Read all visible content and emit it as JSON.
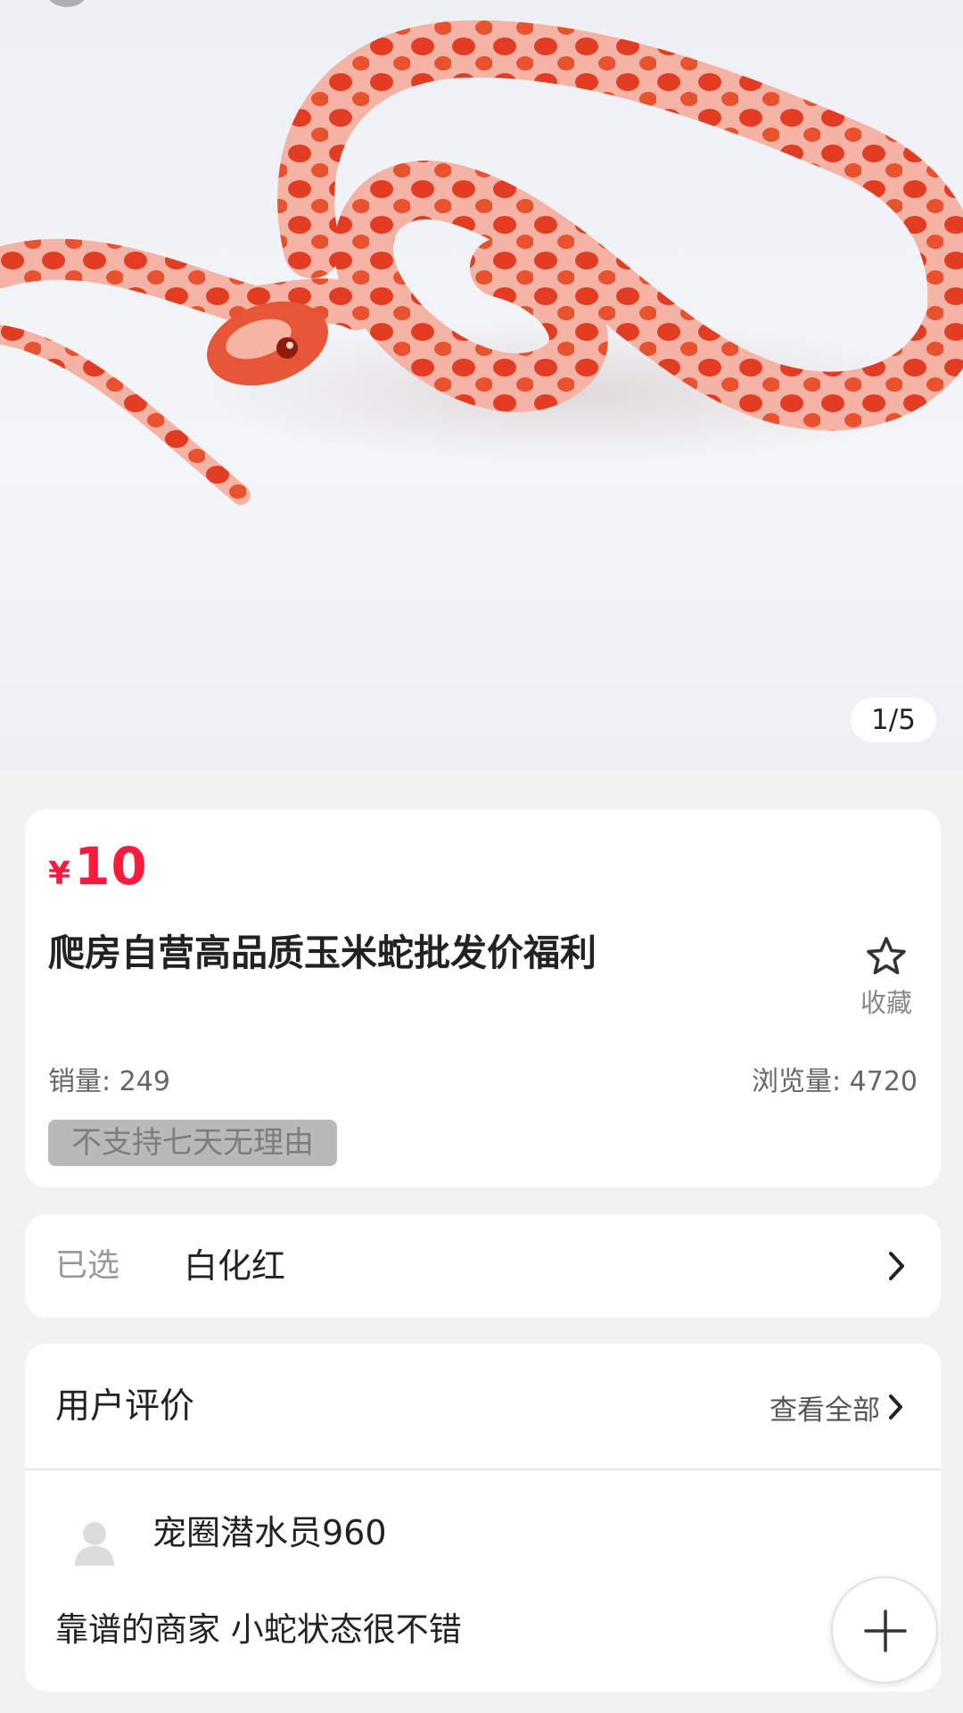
{
  "gallery": {
    "counter": "1/5",
    "image_subject": "corn-snake-photo"
  },
  "product": {
    "currency_symbol": "¥",
    "price": "10",
    "title": "爬房自营高品质玉米蛇批发价福利",
    "favorite_label": "收藏",
    "sales": "销量: 249",
    "views": "浏览量: 4720",
    "policy_tag": "不支持七天无理由"
  },
  "selection": {
    "label": "已选",
    "value": "白化红"
  },
  "reviews": {
    "title": "用户评价",
    "view_all_label": "查看全部",
    "items": [
      {
        "user": "宠圈潜水员960",
        "text": "靠谱的商家 小蛇状态很不错"
      }
    ]
  },
  "colors": {
    "price_red": "#ff1a3d",
    "page_background": "#f2f2f2",
    "tag_background": "#b9b9b9"
  }
}
